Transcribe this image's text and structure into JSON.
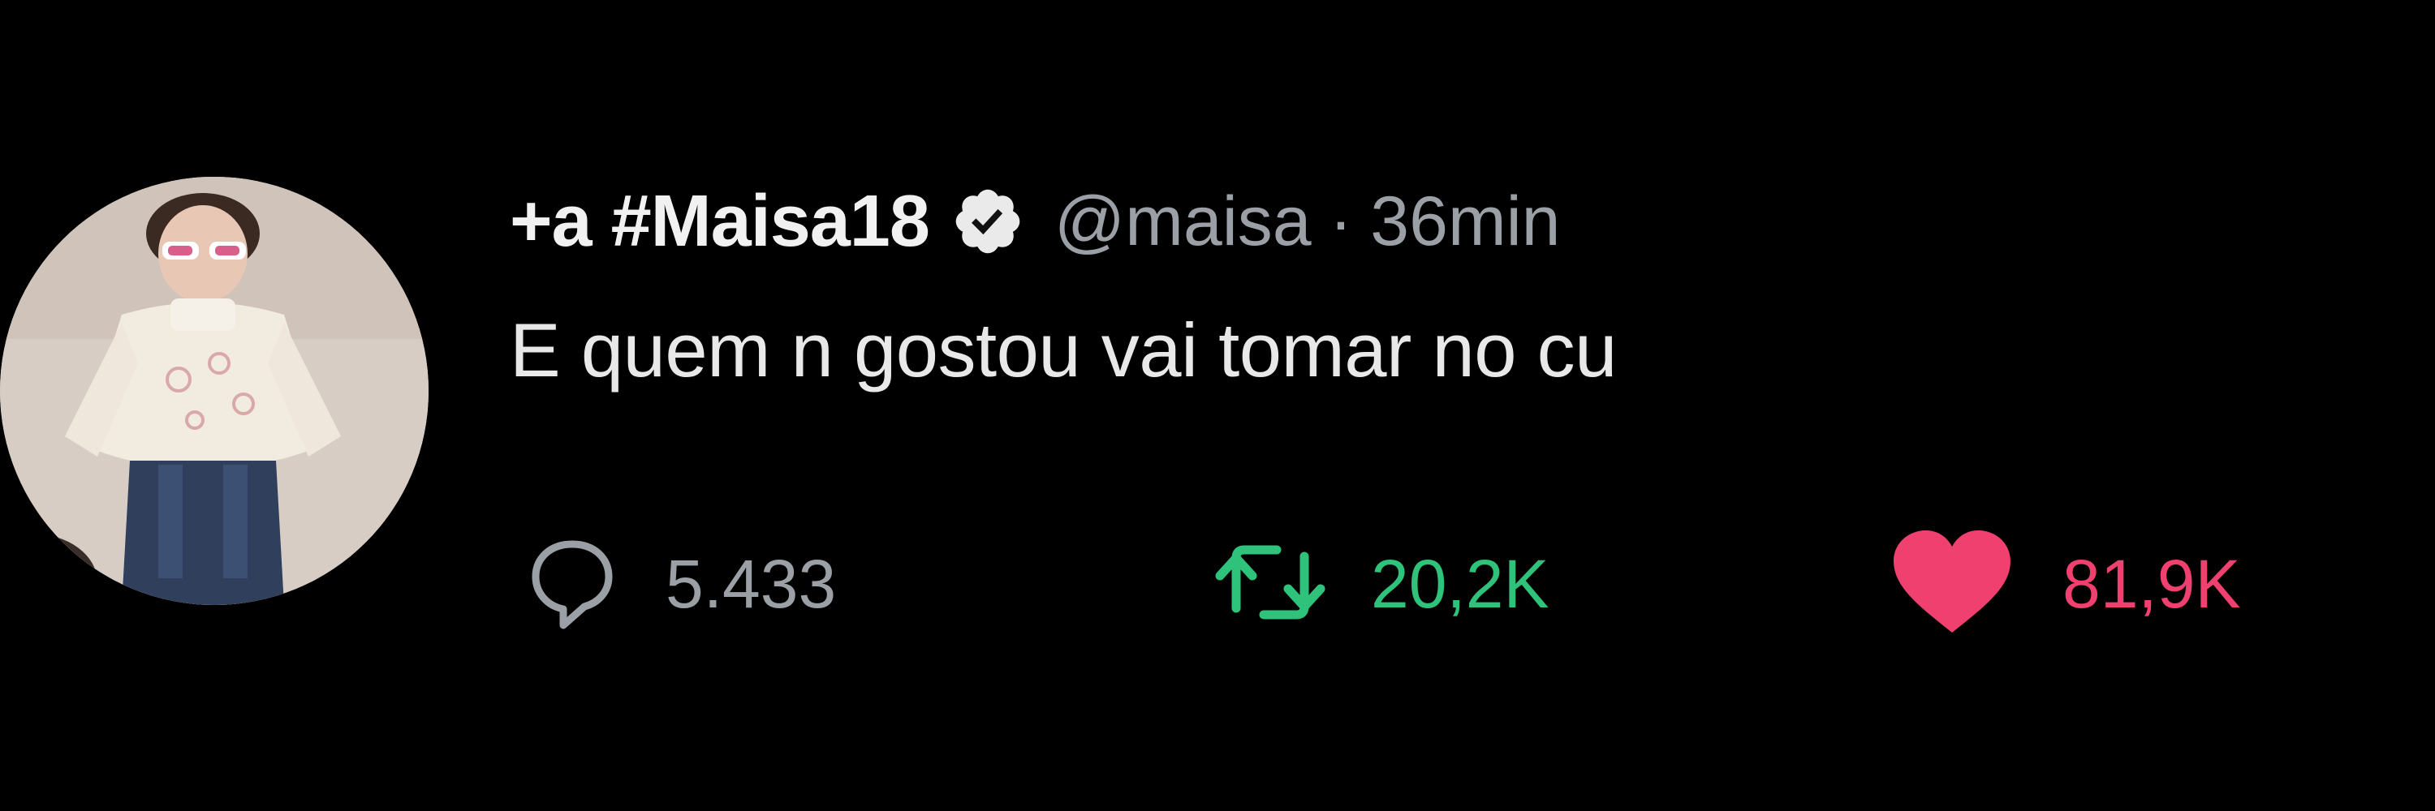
{
  "tweet": {
    "display_name": "+a #Maisa18",
    "handle": "@maisa",
    "separator": "·",
    "time": "36min",
    "text": "E quem n gostou vai tomar no cu",
    "verified_icon": "verified-badge-icon",
    "avatar_description_icon": "profile-photo-avatar"
  },
  "actions": {
    "reply": {
      "icon": "reply-bubble-icon",
      "count": "5.433"
    },
    "retweet": {
      "icon": "retweet-icon",
      "count": "20,2K",
      "active_color": "#2fc27a"
    },
    "like": {
      "icon": "heart-icon",
      "count": "81,9K",
      "active_color": "#f0406f"
    }
  },
  "colors": {
    "background": "#000000",
    "primary_text": "#e7e9ea",
    "secondary_text": "#9aa0a6"
  }
}
